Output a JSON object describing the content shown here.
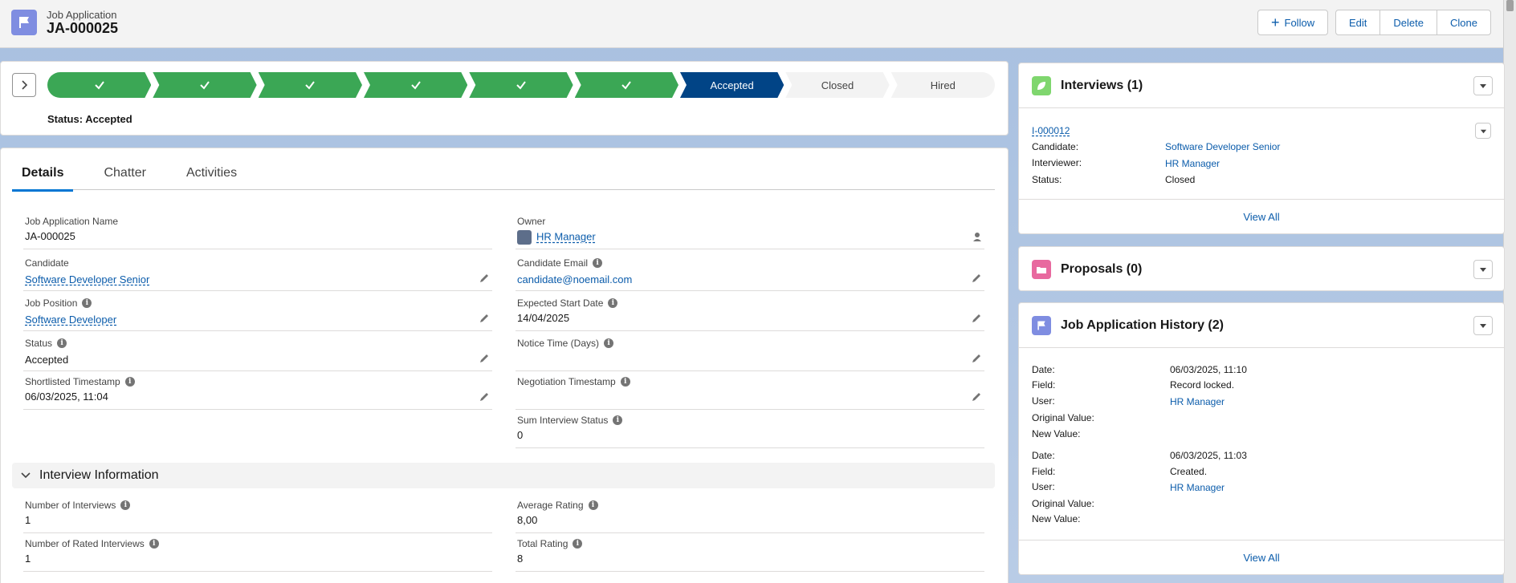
{
  "header": {
    "object_type": "Job Application",
    "record_name": "JA-000025",
    "buttons": {
      "follow": "Follow",
      "edit": "Edit",
      "delete": "Delete",
      "clone": "Clone"
    }
  },
  "path": {
    "steps": [
      {
        "label": "",
        "state": "done"
      },
      {
        "label": "",
        "state": "done"
      },
      {
        "label": "",
        "state": "done"
      },
      {
        "label": "",
        "state": "done"
      },
      {
        "label": "",
        "state": "done"
      },
      {
        "label": "",
        "state": "done"
      },
      {
        "label": "Accepted",
        "state": "current"
      },
      {
        "label": "Closed",
        "state": "todo"
      },
      {
        "label": "Hired",
        "state": "todo"
      }
    ],
    "status_text": "Status: Accepted"
  },
  "tabs": [
    "Details",
    "Chatter",
    "Activities"
  ],
  "fields": {
    "job_application_name": {
      "label": "Job Application Name",
      "value": "JA-000025"
    },
    "owner": {
      "label": "Owner",
      "value": "HR Manager"
    },
    "candidate": {
      "label": "Candidate",
      "value": "Software Developer Senior"
    },
    "candidate_email": {
      "label": "Candidate Email",
      "value": "candidate@noemail.com"
    },
    "job_position": {
      "label": "Job Position",
      "value": "Software Developer"
    },
    "expected_start_date": {
      "label": "Expected Start Date",
      "value": "14/04/2025"
    },
    "status": {
      "label": "Status",
      "value": "Accepted"
    },
    "notice_time": {
      "label": "Notice Time (Days)",
      "value": ""
    },
    "shortlisted_timestamp": {
      "label": "Shortlisted Timestamp",
      "value": "06/03/2025, 11:04"
    },
    "negotiation_timestamp": {
      "label": "Negotiation Timestamp",
      "value": ""
    },
    "sum_interview_status": {
      "label": "Sum Interview Status",
      "value": "0"
    }
  },
  "interview_section": {
    "title": "Interview Information",
    "number_of_interviews": {
      "label": "Number of Interviews",
      "value": "1"
    },
    "average_rating": {
      "label": "Average Rating",
      "value": "8,00"
    },
    "number_of_rated_interviews": {
      "label": "Number of Rated Interviews",
      "value": "1"
    },
    "total_rating": {
      "label": "Total Rating",
      "value": "8"
    }
  },
  "interviews_card": {
    "title": "Interviews (1)",
    "record": "I-000012",
    "rows": [
      {
        "label": "Candidate:",
        "value": "Software Developer Senior"
      },
      {
        "label": "Interviewer:",
        "value": "HR Manager"
      },
      {
        "label": "Status:",
        "value": "Closed"
      }
    ],
    "view_all": "View All"
  },
  "proposals_card": {
    "title": "Proposals (0)"
  },
  "history_card": {
    "title": "Job Application History (2)",
    "entries": [
      {
        "date": "06/03/2025, 11:10",
        "field": "Record locked.",
        "user": "HR Manager",
        "original": "",
        "new": ""
      },
      {
        "date": "06/03/2025, 11:03",
        "field": "Created.",
        "user": "HR Manager",
        "original": "",
        "new": ""
      }
    ],
    "labels": {
      "date": "Date:",
      "field": "Field:",
      "user": "User:",
      "original": "Original Value:",
      "new": "New Value:"
    },
    "view_all": "View All"
  },
  "colors": {
    "brand_blue": "#0b5cab",
    "path_done": "#3ba755",
    "path_current": "#014486",
    "job_app_icon": "#7f8de1",
    "interview_icon": "#7fd66e",
    "proposal_icon": "#e8699f"
  },
  "icons": [
    "flag-icon",
    "plus-icon",
    "chevron-right-icon",
    "check-icon",
    "pencil-icon",
    "info-icon",
    "chevron-down-icon",
    "leaf-icon",
    "folder-icon",
    "change-owner-icon"
  ]
}
